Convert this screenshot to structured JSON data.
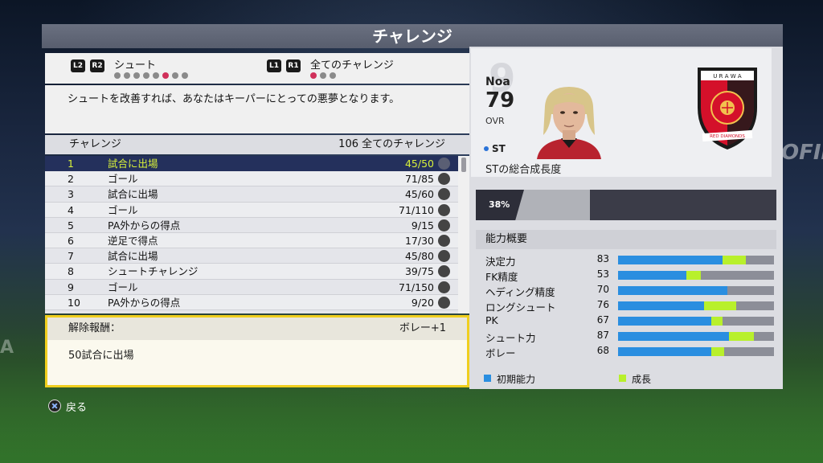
{
  "title": "チャレンジ",
  "tabs": {
    "left": {
      "l_button": "L2",
      "r_button": "R2",
      "label": "シュート",
      "dot_count": 8,
      "active_dot": 5
    },
    "right": {
      "l_button": "L1",
      "r_button": "R1",
      "label": "全てのチャレンジ",
      "dot_count": 3,
      "active_dot": 0
    }
  },
  "description": "シュートを改善すれば、あなたはキーパーにとっての悪夢となります。",
  "list_header": {
    "left": "チャレンジ",
    "right": "106 全てのチャレンジ"
  },
  "challenges": [
    {
      "num": "1",
      "name": "試合に出場",
      "progress": "45/50",
      "selected": true
    },
    {
      "num": "2",
      "name": "ゴール",
      "progress": "71/85"
    },
    {
      "num": "3",
      "name": "試合に出場",
      "progress": "45/60"
    },
    {
      "num": "4",
      "name": "ゴール",
      "progress": "71/110"
    },
    {
      "num": "5",
      "name": "PA外からの得点",
      "progress": "9/15"
    },
    {
      "num": "6",
      "name": "逆足で得点",
      "progress": "17/30"
    },
    {
      "num": "7",
      "name": "試合に出場",
      "progress": "45/80"
    },
    {
      "num": "8",
      "name": "シュートチャレンジ",
      "progress": "39/75"
    },
    {
      "num": "9",
      "name": "ゴール",
      "progress": "71/150"
    },
    {
      "num": "10",
      "name": "PA外からの得点",
      "progress": "9/20"
    }
  ],
  "reward": {
    "label": "解除報酬：",
    "value": "ボレー+1",
    "detail": "50試合に出場"
  },
  "player": {
    "name": "Noa",
    "ovr": "79",
    "ovr_label": "OVR",
    "jersey_number": "9",
    "position": "ST",
    "growth_label": "STの総合成長度",
    "growth_percent": "38%",
    "growth_value": 0.38,
    "club_crest_text": "URAWA RED DIAMONDS"
  },
  "abilities": {
    "header": "能力概要",
    "items": [
      {
        "name": "決定力",
        "value": "83",
        "base": 0.67,
        "growth": 0.15
      },
      {
        "name": "FK精度",
        "value": "53",
        "base": 0.44,
        "growth": 0.09
      },
      {
        "name": "ヘディング精度",
        "value": "70",
        "base": 0.7,
        "growth": 0.0
      },
      {
        "name": "ロングシュート",
        "value": "76",
        "base": 0.55,
        "growth": 0.21
      },
      {
        "name": "PK",
        "value": "67",
        "base": 0.6,
        "growth": 0.07
      },
      {
        "name": "シュート力",
        "value": "87",
        "base": 0.71,
        "growth": 0.16
      },
      {
        "name": "ボレー",
        "value": "68",
        "base": 0.6,
        "growth": 0.08
      }
    ]
  },
  "legend": {
    "base_label": "初期能力",
    "growth_label": "成長",
    "base_color": "#2a8ee0",
    "growth_color": "#b8f02c"
  },
  "back": {
    "label": "戻る"
  }
}
